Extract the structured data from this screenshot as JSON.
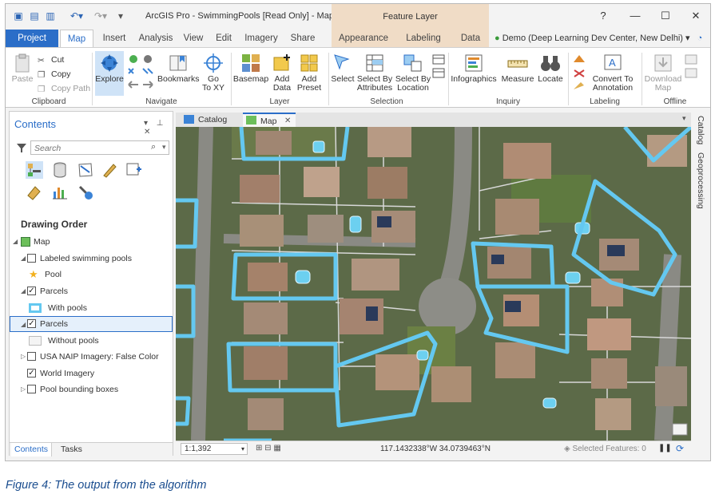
{
  "window": {
    "title": "ArcGIS Pro - SwimmingPools [Read Only] - Map",
    "context_tab_group": "Feature Layer",
    "help_glyph": "?",
    "minimize_glyph": "—",
    "maximize_glyph": "☐",
    "close_glyph": "✕"
  },
  "tabs": [
    "Project",
    "Map",
    "Insert",
    "Analysis",
    "View",
    "Edit",
    "Imagery",
    "Share",
    "Appearance",
    "Labeling",
    "Data"
  ],
  "user": {
    "label": "Demo (Deep Learning Dev Center, New Delhi)",
    "dropdown_glyph": "▾"
  },
  "ribbon": {
    "clipboard": {
      "label": "Clipboard",
      "paste": "Paste",
      "cut": "Cut",
      "copy": "Copy",
      "copy_path": "Copy Path"
    },
    "navigate": {
      "label": "Navigate",
      "explore": "Explore",
      "bookmarks": "Bookmarks",
      "go_to_xy_1": "Go",
      "go_to_xy_2": "To XY"
    },
    "layer": {
      "label": "Layer",
      "basemap": "Basemap",
      "add_data_1": "Add",
      "add_data_2": "Data",
      "add_preset_1": "Add",
      "add_preset_2": "Preset"
    },
    "selection": {
      "label": "Selection",
      "select": "Select",
      "select_by_attributes_1": "Select By",
      "select_by_attributes_2": "Attributes",
      "select_by_location_1": "Select By",
      "select_by_location_2": "Location"
    },
    "inquiry": {
      "label": "Inquiry",
      "infographics": "Infographics",
      "measure": "Measure",
      "locate": "Locate"
    },
    "labeling": {
      "label": "Labeling",
      "convert_1": "Convert To",
      "convert_2": "Annotation"
    },
    "offline": {
      "label": "Offline",
      "download_1": "Download",
      "download_2": "Map"
    }
  },
  "contents": {
    "title": "Contents",
    "search_placeholder": "Search",
    "drawing_order": "Drawing Order",
    "layers": {
      "map": "Map",
      "labeled_pools": "Labeled swimming pools",
      "pool": "Pool",
      "parcels_with": "Parcels",
      "with_pools": "With pools",
      "parcels_without": "Parcels",
      "without_pools": "Without pools",
      "naip": "USA NAIP Imagery: False Color",
      "world_imagery": "World Imagery",
      "pool_boxes": "Pool bounding boxes"
    },
    "bottom_tabs": [
      "Contents",
      "Tasks"
    ],
    "pin_glyphs": "▾ ⊥ ✕"
  },
  "view_tabs": {
    "catalog": "Catalog",
    "map": "Map",
    "close_glyph": "✕",
    "more_glyph": "▾"
  },
  "side_tabs": [
    "Catalog",
    "Geoprocessing"
  ],
  "statusbar": {
    "scale": "1:1,392",
    "coordinates": "117.1432338°W 34.0739463°N",
    "selected_features": "Selected Features: 0",
    "pause_glyph": "❚❚",
    "refresh_glyph": "⟳"
  },
  "caption": "Figure 4: The output from the  algorithm",
  "colors": {
    "accent": "#2b6ec8",
    "parcel_outline": "#64c8f0",
    "context_tab": "#f0dcc6"
  }
}
